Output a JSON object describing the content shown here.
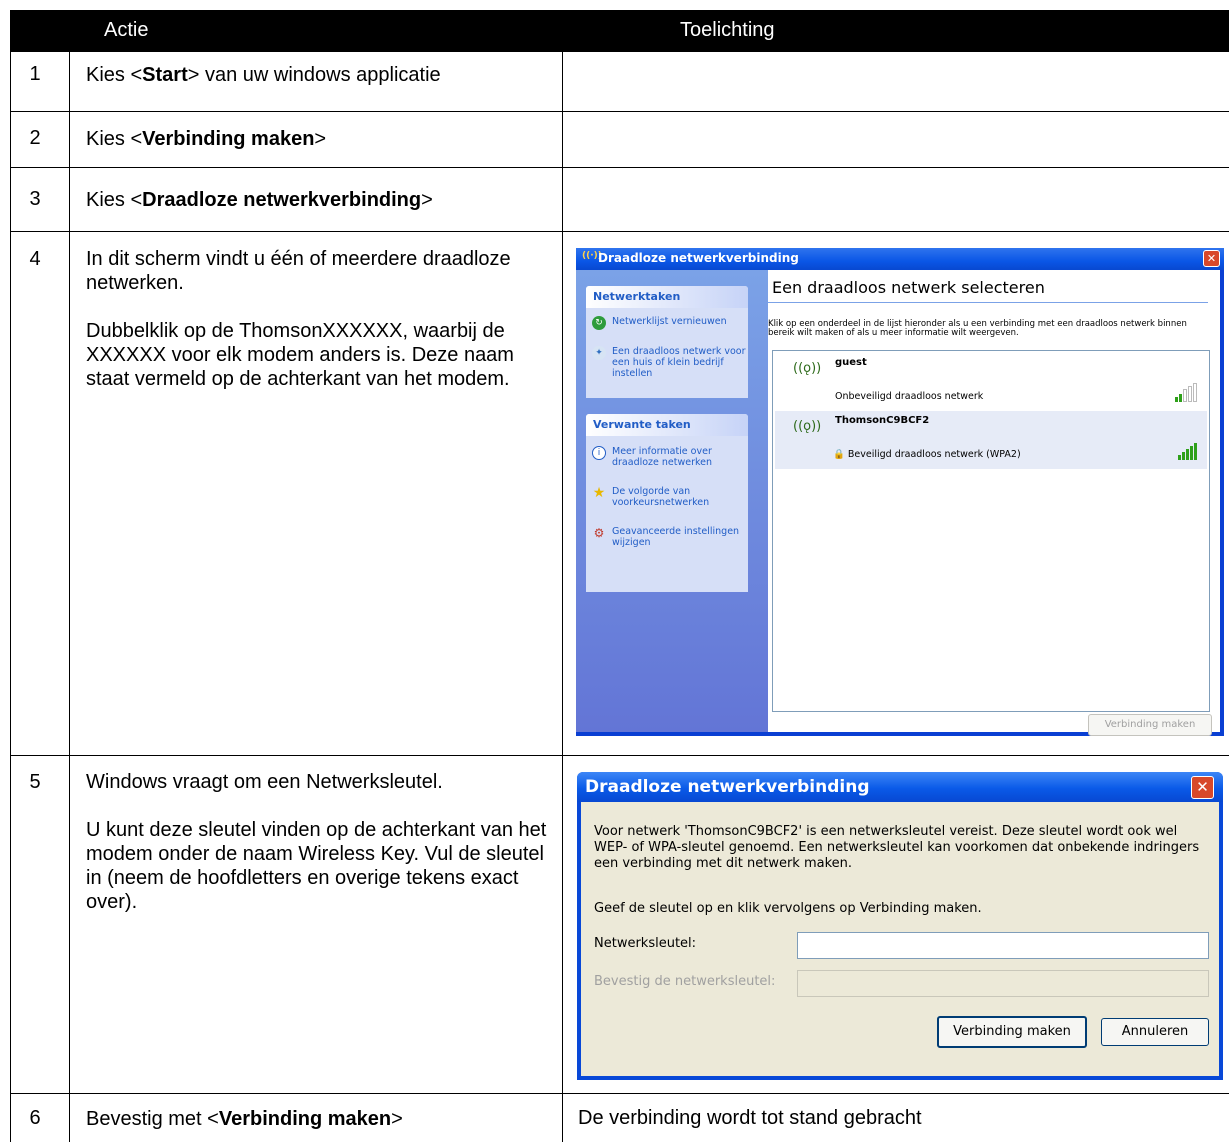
{
  "table": {
    "header": {
      "actie": "Actie",
      "toelichting": "Toelichting"
    },
    "rows": [
      {
        "num": "1",
        "pre": "Kies <",
        "bold": "Start",
        "post": "> van uw windows applicatie"
      },
      {
        "num": "2",
        "pre": "Kies <",
        "bold": "Verbinding maken",
        "post": ">"
      },
      {
        "num": "3",
        "pre": "Kies <",
        "bold": "Draadloze netwerkverbinding",
        "post": ">"
      },
      {
        "num": "4",
        "p1": "In dit scherm vindt u één of meerdere draadloze netwerken.",
        "p2": "Dubbelklik op de ThomsonXXXXXX, waarbij de XXXXXX voor elk modem anders is.  Deze naam staat vermeld op de achterkant van het modem."
      },
      {
        "num": "5",
        "p1": "Windows vraagt om een Netwerksleutel.",
        "p2": "U kunt deze sleutel vinden op de achterkant van het modem onder de naam Wireless Key. Vul de sleutel in (neem de hoofdletters en overige tekens exact over)."
      },
      {
        "num": "6",
        "pre": "Bevestig met <",
        "bold": "Verbinding maken",
        "post": ">",
        "toelichting": "De verbinding wordt tot stand gebracht"
      }
    ]
  },
  "dialog1": {
    "title": "Draadloze netwerkverbinding",
    "panel1": {
      "heading": "Netwerktaken",
      "items": [
        "Netwerklijst vernieuwen",
        "Een draadloos netwerk voor een huis of klein bedrijf instellen"
      ]
    },
    "panel2": {
      "heading": "Verwante taken",
      "items": [
        "Meer informatie over draadloze netwerken",
        "De volgorde van voorkeursnetwerken",
        "Geavanceerde instellingen wijzigen"
      ]
    },
    "heading": "Een draadloos netwerk selecteren",
    "description": "Klik op een onderdeel in de lijst hieronder als u een verbinding met een draadloos netwerk binnen bereik wilt maken of als u meer informatie wilt weergeven.",
    "networks": [
      {
        "name": "guest",
        "status": "Onbeveiligd draadloos netwerk",
        "signal_bars": 2,
        "signal_max": 5
      },
      {
        "name": "ThomsonC9BCF2",
        "status": "Beveiligd draadloos netwerk (WPA2)",
        "signal_bars": 5,
        "signal_max": 5,
        "secured": true
      }
    ],
    "button": "Verbinding maken"
  },
  "dialog2": {
    "title": "Draadloze netwerkverbinding",
    "message": "Voor netwerk 'ThomsonC9BCF2' is een netwerksleutel vereist. Deze sleutel wordt ook wel WEP- of WPA-sleutel genoemd. Een netwerksleutel kan voorkomen dat onbekende indringers een verbinding met dit netwerk maken.",
    "instruction": "Geef de sleutel op en klik vervolgens op Verbinding maken.",
    "field1_label": "Netwerksleutel:",
    "field1_value": "",
    "field2_label": "Bevestig de netwerksleutel:",
    "field2_value": "",
    "ok_button": "Verbinding maken",
    "cancel_button": "Annuleren"
  },
  "colors": {
    "xp_blue": "#0a56e6",
    "header_bg": "#000000",
    "panel_link": "#215dc6",
    "signal_green": "#2ea01a"
  },
  "icons": {
    "close": "close-icon",
    "wireless": "wireless-antenna-icon",
    "refresh": "refresh-icon",
    "lock": "lock-icon",
    "info": "info-icon",
    "star": "star-icon",
    "settings": "settings-icon"
  }
}
